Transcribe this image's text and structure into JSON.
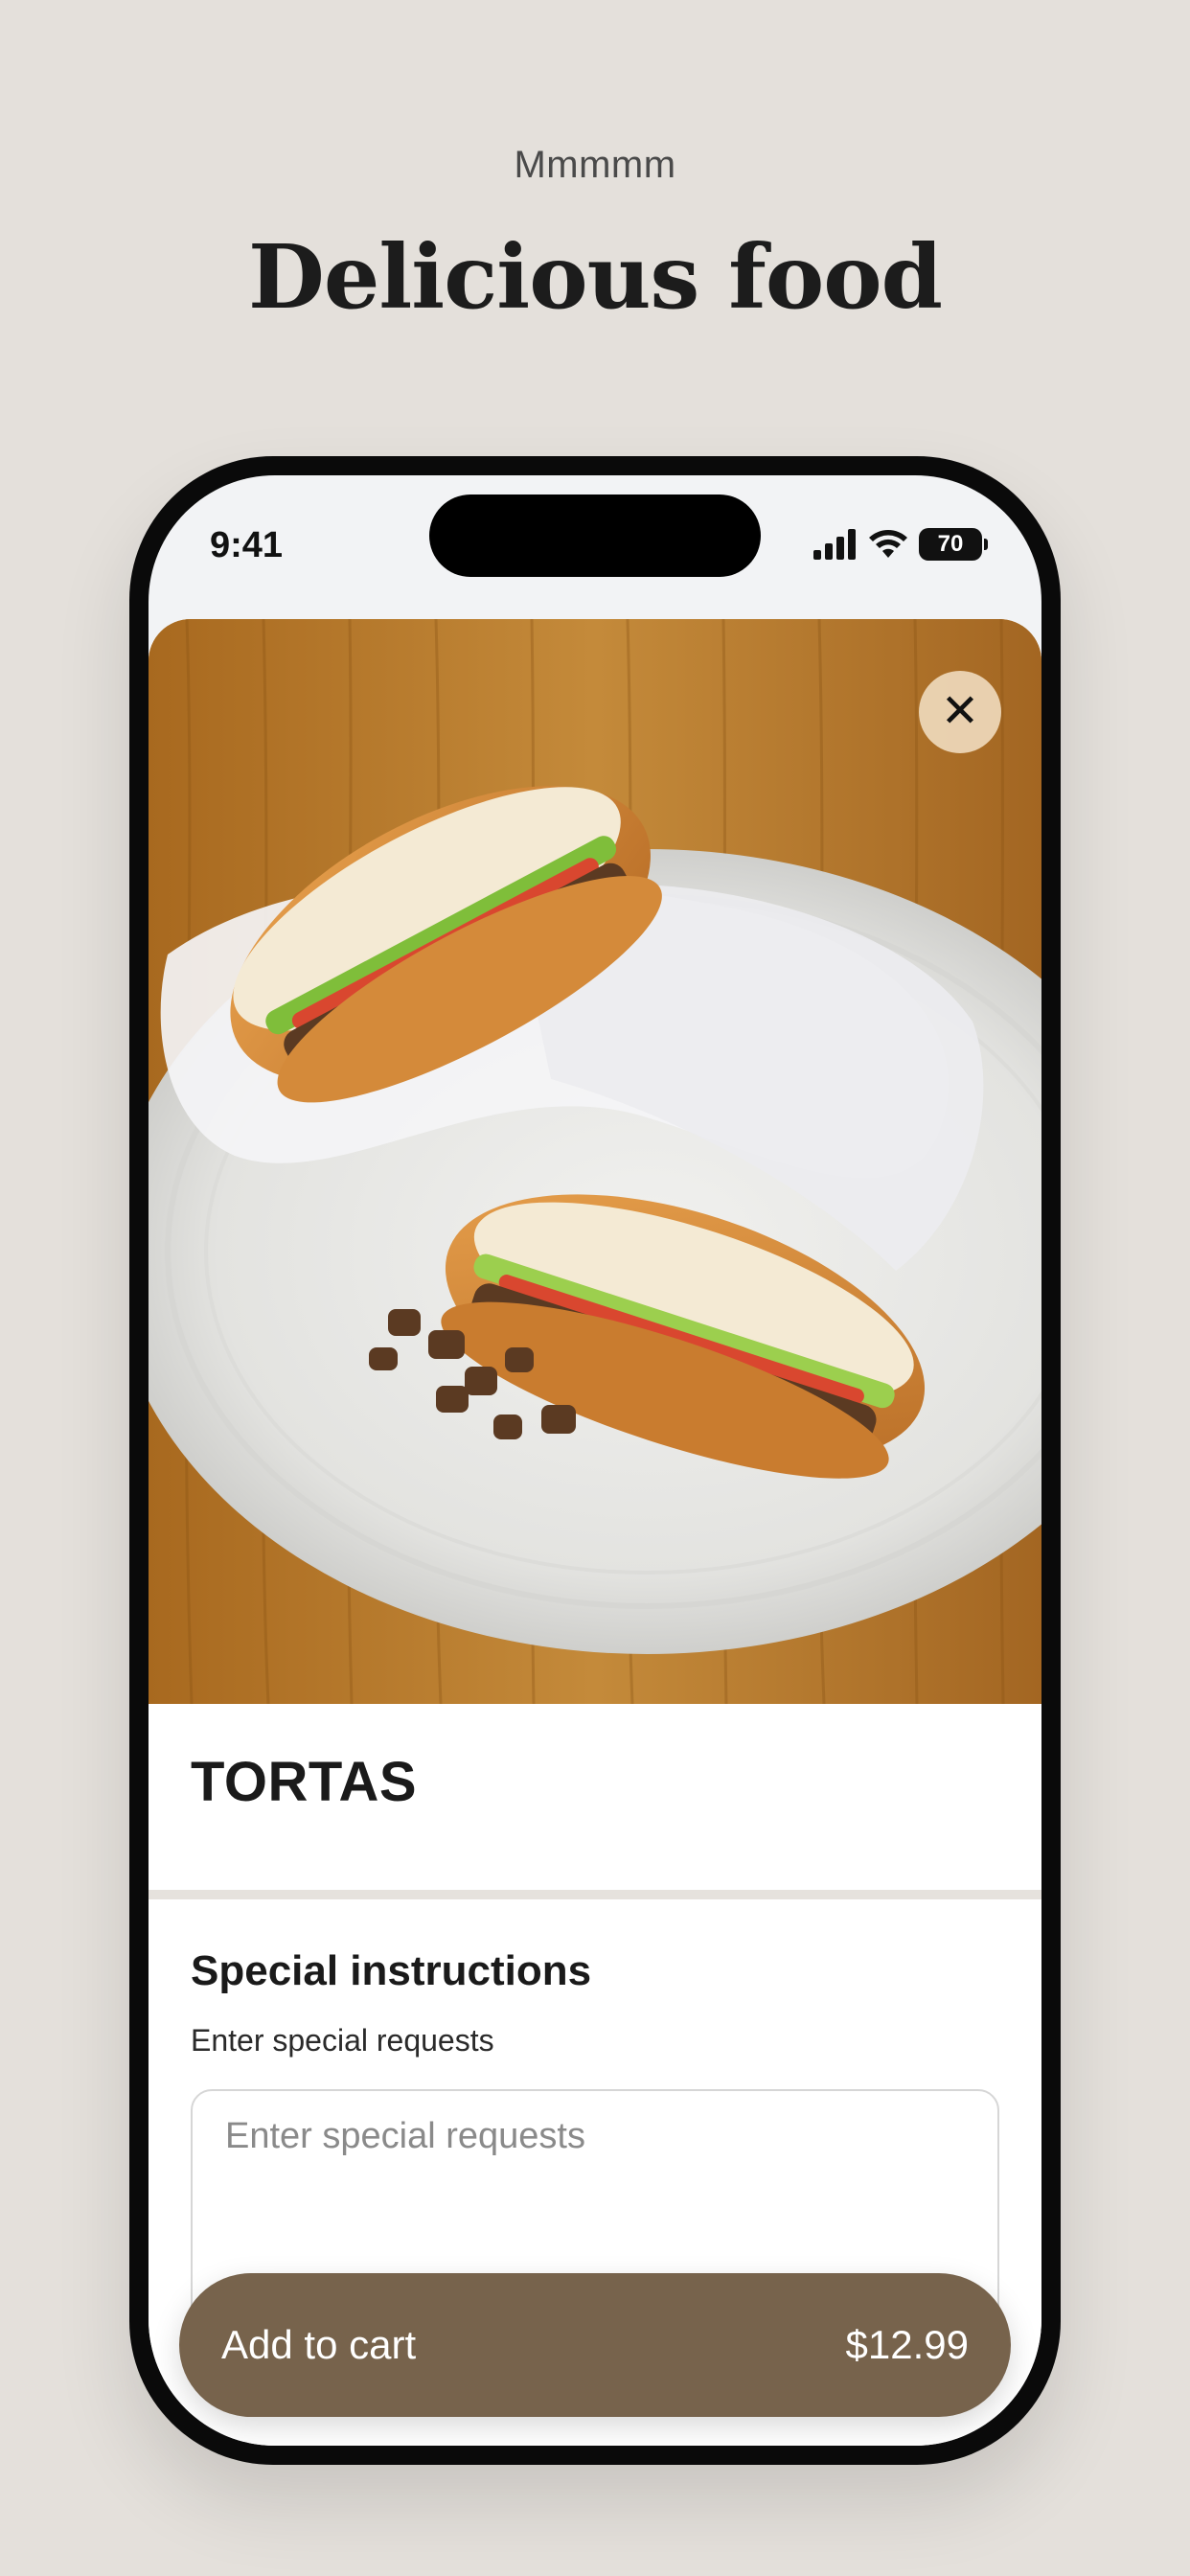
{
  "promo": {
    "eyebrow": "Mmmmm",
    "title": "Delicious food"
  },
  "status_bar": {
    "time": "9:41",
    "battery": "70"
  },
  "item": {
    "image_icon": "torta-sandwich-photo",
    "close_icon": "close-icon",
    "title": "TORTAS"
  },
  "special_instructions": {
    "title": "Special instructions",
    "subtitle": "Enter special requests",
    "placeholder": "Enter special requests"
  },
  "cart": {
    "label": "Add to cart",
    "price": "$12.99"
  },
  "colors": {
    "background": "#e4e0db",
    "accent_button": "#77634c",
    "close_button": "#ecd6b6"
  }
}
